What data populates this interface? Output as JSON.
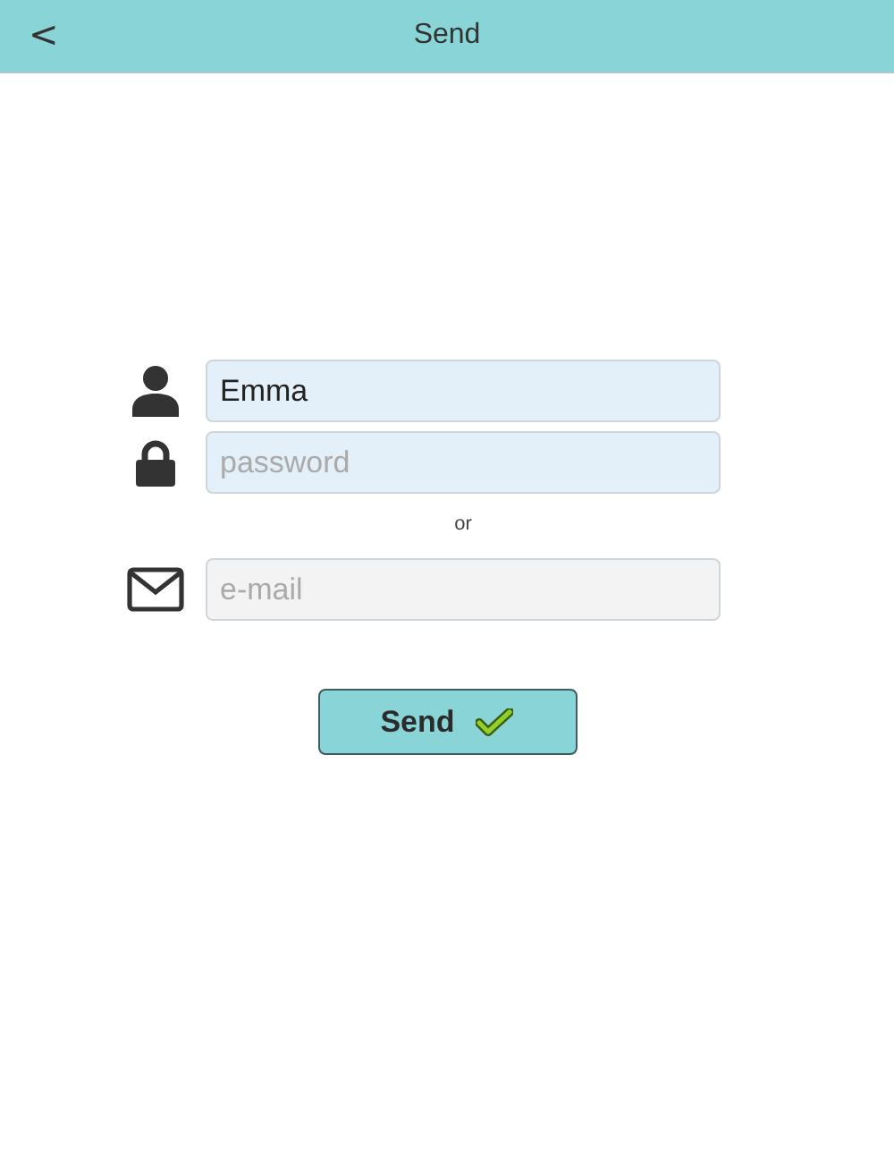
{
  "header": {
    "back": "<",
    "title": "Send"
  },
  "fields": [
    {
      "kind": "user",
      "value": "Emma",
      "highlighted": true
    },
    {
      "kind": "password",
      "placeholder": "password",
      "highlighted": true
    },
    {
      "kind": "separator",
      "text": "or"
    },
    {
      "kind": "email",
      "placeholder": "e-mail",
      "highlighted": false
    }
  ],
  "button": {
    "label": "Send"
  }
}
